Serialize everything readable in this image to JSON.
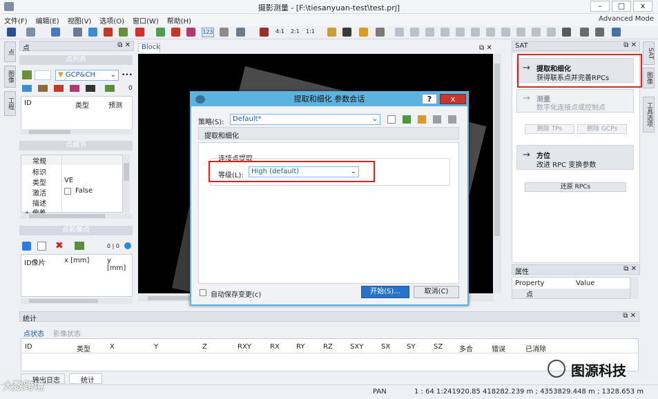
{
  "window": {
    "title": "摄影测量 - [F:\\tiesanyuan-test\\test.prj]",
    "mode": "Advanced Mode",
    "btn_min": "–",
    "btn_max": "□",
    "btn_close": "x"
  },
  "menu": [
    "文件(F)",
    "编辑(E)",
    "视图(V)",
    "选项(O)",
    "窗口(W)",
    "帮助(H)"
  ],
  "toolbar": {
    "zoom_41": "4:1",
    "zoom_21": "2:1",
    "zoom_11": "1:1",
    "numbers": "123"
  },
  "left_vtabs": [
    "点",
    "图像",
    "工程"
  ],
  "points_panel": {
    "title": "点",
    "list_section": "点列表",
    "filter": "GCP&CH",
    "more": "•••",
    "count": "0",
    "columns": [
      "ID",
      "类型",
      "预测"
    ],
    "detail_section": "点细节",
    "detail_rows": [
      {
        "k": "常规",
        "v": ""
      },
      {
        "k": "标识",
        "v": ""
      },
      {
        "k": "类型",
        "v": "VE"
      },
      {
        "k": "激活",
        "v": "False"
      },
      {
        "k": "描述",
        "v": ""
      },
      {
        "k": "+ 偏差",
        "v": ""
      }
    ],
    "image_section": "点影像点",
    "image_count": "0 | 0",
    "image_columns": [
      "ID像片",
      "x [mm]",
      "y [mm]"
    ]
  },
  "block_tab": "Block",
  "dialog": {
    "title": "提取和细化 参数会话",
    "strategy_label": "策略(S):",
    "strategy_value": "Default*",
    "tab": "提取和细化",
    "group": "连接点提取",
    "level_label": "等级(L):",
    "level_value": "High (default)",
    "autosave": "自动保存变更(c)",
    "start": "开始(S)...",
    "cancel": "取消(C)",
    "help": "?",
    "close": "x"
  },
  "sat_panel": {
    "title": "SAT",
    "cards": [
      {
        "h": "提取和细化",
        "s": "获得联系点并完善RPCs",
        "active": true
      },
      {
        "h": "测量",
        "s": "数字化连接点或控制点",
        "active": false
      },
      {
        "h": "方位",
        "s": "改进 RPC 变换参数",
        "active": true
      }
    ],
    "btn_tps": "删除 TPs",
    "btn_gcps": "删除 GCPs",
    "btn_restore": "还原 RPCs"
  },
  "props_panel": {
    "title": "属性",
    "col1": "Property",
    "col2": "Value",
    "row": "点"
  },
  "right_vtabs": [
    "SAT",
    "图像",
    "工具选项"
  ],
  "stats": {
    "title": "统计",
    "tab1": "点状态",
    "tab2": "影像状态",
    "columns": [
      "ID",
      "类型",
      "X",
      "Y",
      "Z",
      "RXY",
      "RX",
      "RY",
      "RZ",
      "SXY",
      "SX",
      "SY",
      "SZ",
      "多合",
      "错误",
      "已消除"
    ]
  },
  "bottom_tabs": [
    "输出日志",
    "统计"
  ],
  "statusbar": {
    "mode": "PAN",
    "coords": "1 : 64  1:241920.85  418282.239 m ; 4353829.448 m ; 1328.653 m"
  },
  "watermark": {
    "left": "大数跨境",
    "right": "图源科技"
  }
}
